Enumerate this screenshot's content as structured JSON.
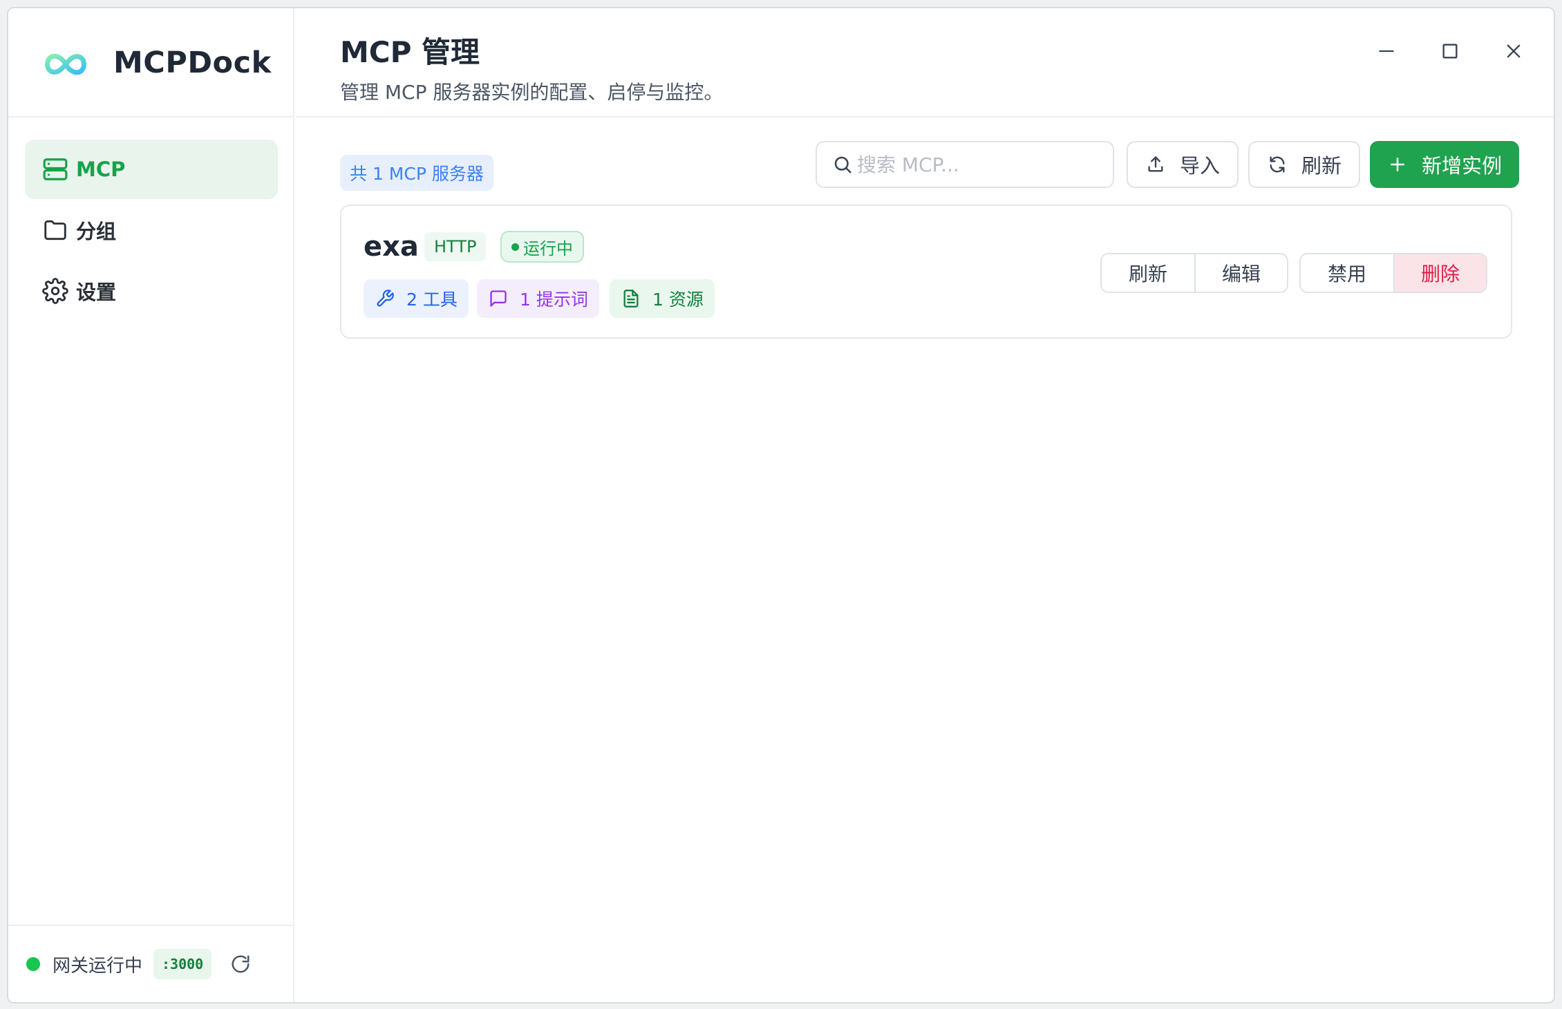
{
  "app": {
    "name": "MCPDock"
  },
  "sidebar": {
    "items": [
      {
        "label": "MCP",
        "icon": "server-icon",
        "active": true
      },
      {
        "label": "分组",
        "icon": "folder-icon",
        "active": false
      },
      {
        "label": "设置",
        "icon": "gear-icon",
        "active": false
      }
    ],
    "footer": {
      "status_text": "网关运行中",
      "port": ":3000",
      "status_color": "#16c64e"
    }
  },
  "header": {
    "title": "MCP 管理",
    "subtitle": "管理 MCP 服务器实例的配置、启停与监控。"
  },
  "toolbar": {
    "count_label": "共 1 MCP 服务器",
    "search_placeholder": "搜索 MCP...",
    "search_value": "",
    "import_label": "导入",
    "refresh_label": "刷新",
    "add_label": "新增实例",
    "accent_color": "#1fa34e"
  },
  "instances": [
    {
      "name": "exa",
      "protocol": "HTTP",
      "status": "运行中",
      "tools": "2 工具",
      "prompts": "1 提示词",
      "resources": "1 资源",
      "actions": {
        "refresh": "刷新",
        "edit": "编辑",
        "disable": "禁用",
        "delete": "删除"
      }
    }
  ]
}
